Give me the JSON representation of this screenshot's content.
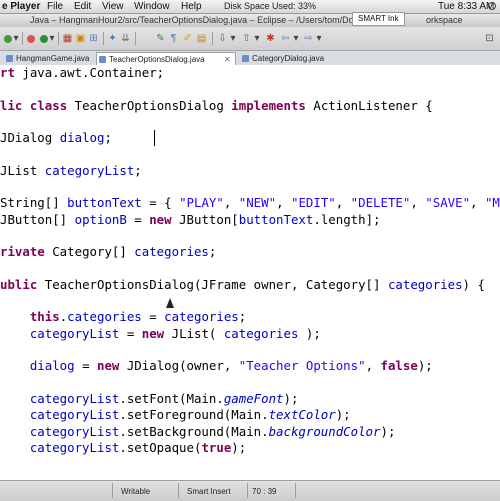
{
  "menubar": {
    "app_name": "e Player",
    "items": [
      "File",
      "Edit",
      "View",
      "Window",
      "Help"
    ],
    "disk_space": "Disk Space Used: 33%",
    "smart_ink": "SMART Ink",
    "clock": "Tue 8:33 AM"
  },
  "window": {
    "title": "Java – HangmanHour2/src/TeacherOptionsDialog.java – Eclipse – /Users/tom/Docu",
    "title_tail": "orkspace"
  },
  "editor_tabs": [
    {
      "label": "HangmanGame.java",
      "active": false
    },
    {
      "label": "TeacherOptionsDialog.java",
      "active": true
    },
    {
      "label": "CategoryDialog.java",
      "active": false
    }
  ],
  "code_lines": [
    "rt java.awt.Container;",
    "",
    "lic class TeacherOptionsDialog implements ActionListener {",
    "",
    "JDialog dialog;",
    "",
    "JList categoryList;",
    "",
    "String[] buttonText = { \"PLAY\", \"NEW\", \"EDIT\", \"DELETE\", \"SAVE\", \"MAIN M",
    "JButton[] optionB = new JButton[buttonText.length];",
    "",
    "rivate Category[] categories;",
    "",
    "ublic TeacherOptionsDialog(JFrame owner, Category[] categories) {",
    "",
    "    this.categories = categories;",
    "    categoryList = new JList( categories );",
    "",
    "    dialog = new JDialog(owner, \"Teacher Options\", false);",
    "",
    "    categoryList.setFont(Main.gameFont);",
    "    categoryList.setForeground(Main.textColor);",
    "    categoryList.setBackground(Main.backgroundColor);",
    "    categoryList.setOpaque(true);"
  ],
  "status": {
    "writable": "Writable",
    "insert_mode": "Smart Insert",
    "position": "70 : 39"
  },
  "colors": {
    "keyword": "#7f0055",
    "field": "#0000c0",
    "string": "#2a00ff"
  }
}
